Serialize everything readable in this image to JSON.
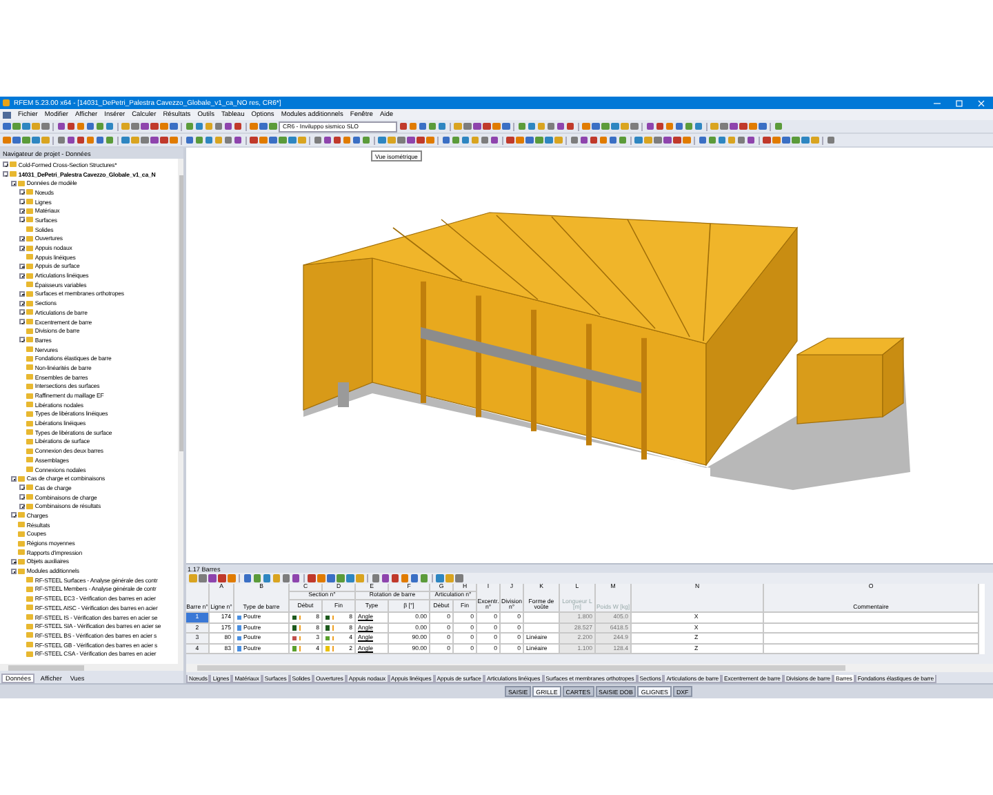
{
  "window": {
    "title": "RFEM 5.23.00 x64 - [14031_DePetri_Palestra Cavezzo_Globale_v1_ca_NO res, CR6*]"
  },
  "menu": [
    "Fichier",
    "Modifier",
    "Afficher",
    "Insérer",
    "Calculer",
    "Résultats",
    "Outils",
    "Tableau",
    "Options",
    "Modules additionnels",
    "Fenêtre",
    "Aide"
  ],
  "toolbar": {
    "load_case": "CR6 - Inviluppo sismico SLO",
    "tooltip": "Vue isométrique"
  },
  "navigator": {
    "title": "Navigateur de projet - Données",
    "tree": [
      {
        "label": "Cold-Formed Cross-Section Structures*",
        "expanded": false
      },
      {
        "label": "14031_DePetri_Palestra Cavezzo_Globale_v1_ca_N",
        "expanded": true,
        "children": [
          {
            "label": "Données de modèle",
            "expanded": true,
            "children": [
              {
                "label": "Nœuds",
                "expanded": false
              },
              {
                "label": "Lignes",
                "expanded": false
              },
              {
                "label": "Matériaux",
                "expanded": false
              },
              {
                "label": "Surfaces",
                "expanded": false
              },
              {
                "label": "Solides"
              },
              {
                "label": "Ouvertures",
                "expanded": false
              },
              {
                "label": "Appuis nodaux",
                "expanded": false
              },
              {
                "label": "Appuis linéiques"
              },
              {
                "label": "Appuis de surface",
                "expanded": false
              },
              {
                "label": "Articulations linéiques",
                "expanded": false
              },
              {
                "label": "Épaisseurs variables"
              },
              {
                "label": "Surfaces et membranes orthotropes",
                "expanded": false
              },
              {
                "label": "Sections",
                "expanded": false
              },
              {
                "label": "Articulations de barre",
                "expanded": false
              },
              {
                "label": "Excentrement de barre",
                "expanded": false
              },
              {
                "label": "Divisions de barre"
              },
              {
                "label": "Barres",
                "expanded": false
              },
              {
                "label": "Nervures"
              },
              {
                "label": "Fondations élastiques de barre"
              },
              {
                "label": "Non-linéarités de barre"
              },
              {
                "label": "Ensembles de barres"
              },
              {
                "label": "Intersections des surfaces"
              },
              {
                "label": "Raffinement du maillage EF"
              },
              {
                "label": "Libérations nodales"
              },
              {
                "label": "Types de libérations linéiques"
              },
              {
                "label": "Libérations linéiques"
              },
              {
                "label": "Types de libérations de surface"
              },
              {
                "label": "Libérations de surface"
              },
              {
                "label": "Connexion des deux barres"
              },
              {
                "label": "Assemblages"
              },
              {
                "label": "Connexions nodales"
              }
            ]
          },
          {
            "label": "Cas de charge et combinaisons",
            "expanded": true,
            "children": [
              {
                "label": "Cas de charge",
                "expanded": false
              },
              {
                "label": "Combinaisons de charge",
                "expanded": false
              },
              {
                "label": "Combinaisons de résultats",
                "expanded": false
              }
            ]
          },
          {
            "label": "Charges",
            "expanded": false
          },
          {
            "label": "Résultats"
          },
          {
            "label": "Coupes"
          },
          {
            "label": "Régions moyennes"
          },
          {
            "label": "Rapports d'impression"
          },
          {
            "label": "Objets auxiliaires",
            "expanded": false
          },
          {
            "label": "Modules additionnels",
            "expanded": true,
            "children": [
              {
                "label": "RF-STEEL Surfaces - Analyse générale des contr"
              },
              {
                "label": "RF-STEEL Members - Analyse générale de contr"
              },
              {
                "label": "RF-STEEL EC3 - Vérification des barres en acier"
              },
              {
                "label": "RF-STEEL AISC - Vérification des barres en acier"
              },
              {
                "label": "RF-STEEL IS - Vérification des barres en acier se"
              },
              {
                "label": "RF-STEEL SIA - Vérification des barres en acier se"
              },
              {
                "label": "RF-STEEL BS - Vérification des barres en acier s"
              },
              {
                "label": "RF-STEEL GB - Vérification des barres en acier s"
              },
              {
                "label": "RF-STEEL CSA - Vérification des barres en acier"
              }
            ]
          }
        ]
      }
    ],
    "tabs": [
      {
        "label": "Données",
        "selected": true
      },
      {
        "label": "Afficher",
        "selected": false
      },
      {
        "label": "Vues",
        "selected": false
      }
    ]
  },
  "table": {
    "title": "1.17 Barres",
    "header": [
      {
        "label": "Barre n°"
      },
      {
        "letter": "A",
        "label": "Ligne n°"
      },
      {
        "letter": "B",
        "label": "Type de barre"
      },
      {
        "group": "Section n°",
        "columns": [
          {
            "letter": "C",
            "label": "Début"
          },
          {
            "letter": "D",
            "label": "Fin"
          }
        ]
      },
      {
        "group": "Rotation de barre",
        "columns": [
          {
            "letter": "E",
            "label": "Type"
          },
          {
            "letter": "F",
            "label": "β [°]"
          }
        ]
      },
      {
        "group": "Articulation n°",
        "columns": [
          {
            "letter": "G",
            "label": "Début"
          },
          {
            "letter": "H",
            "label": "Fin"
          }
        ]
      },
      {
        "letter": "I",
        "label": "Excentr. n°"
      },
      {
        "letter": "J",
        "label": "Division n°"
      },
      {
        "letter": "K",
        "label": "Forme de voûte"
      },
      {
        "letter": "L",
        "label": "Longueur L [m]",
        "disabled": true
      },
      {
        "letter": "M",
        "label": "Poids W [kg]",
        "disabled": true
      },
      {
        "letter": "N"
      },
      {
        "letter": "O",
        "label": "Commentaire"
      }
    ],
    "rows": [
      {
        "number": "1",
        "selected": true,
        "cells": [
          "174",
          {
            "text": "Poutre",
            "color": "#4a8fe0"
          },
          {
            "text": "8",
            "color": "#1e5a1e"
          },
          {
            "text": "8",
            "color": "#1e5a1e"
          },
          "Angle",
          "0.00",
          "0",
          "0",
          "0",
          "0",
          null,
          "1.800",
          "405.0",
          "X"
        ]
      },
      {
        "number": "2",
        "selected": false,
        "cells": [
          "175",
          {
            "text": "Poutre",
            "color": "#4a8fe0"
          },
          {
            "text": "8",
            "color": "#1e5a1e"
          },
          {
            "text": "8",
            "color": "#1e5a1e"
          },
          "Angle",
          "0.00",
          "0",
          "0",
          "0",
          "0",
          null,
          "28.527",
          "6418.5",
          "X"
        ]
      },
      {
        "number": "3",
        "selected": false,
        "cells": [
          "80",
          {
            "text": "Poutre",
            "color": "#4a8fe0"
          },
          {
            "text": "3",
            "color": "#c0504d"
          },
          {
            "text": "4",
            "color": "#5aa02c"
          },
          "Angle",
          "90.00",
          "0",
          "0",
          "0",
          "0",
          "Linéaire",
          "2.200",
          "244.9",
          "Z"
        ]
      },
      {
        "number": "4",
        "selected": false,
        "cells": [
          "83",
          {
            "text": "Poutre",
            "color": "#4a8fe0"
          },
          {
            "text": "4",
            "color": "#5aa02c"
          },
          {
            "text": "2",
            "color": "#e8c000"
          },
          "Angle",
          "90.00",
          "0",
          "0",
          "0",
          "0",
          "Linéaire",
          "1.100",
          "128.4",
          "Z"
        ]
      }
    ],
    "sheets": [
      {
        "label": "Nœuds",
        "selected": false
      },
      {
        "label": "Lignes",
        "selected": false
      },
      {
        "label": "Matériaux",
        "selected": false
      },
      {
        "label": "Surfaces",
        "selected": false
      },
      {
        "label": "Solides",
        "selected": false
      },
      {
        "label": "Ouvertures",
        "selected": false
      },
      {
        "label": "Appuis nodaux",
        "selected": false
      },
      {
        "label": "Appuis linéiques",
        "selected": false
      },
      {
        "label": "Appuis de surface",
        "selected": false
      },
      {
        "label": "Articulations linéiques",
        "selected": false
      },
      {
        "label": "Surfaces et membranes orthotropes",
        "selected": false
      },
      {
        "label": "Sections",
        "selected": false
      },
      {
        "label": "Articulations de barre",
        "selected": false
      },
      {
        "label": "Excentrement de barre",
        "selected": false
      },
      {
        "label": "Divisions de barre",
        "selected": false
      },
      {
        "label": "Barres",
        "selected": true
      },
      {
        "label": "Fondations élastiques de barre",
        "selected": false
      }
    ]
  },
  "status_bar": [
    {
      "label": "SAISIE",
      "on": false
    },
    {
      "label": "GRILLE",
      "on": true
    },
    {
      "label": "CARTES",
      "on": false
    },
    {
      "label": "SAISIE DOB",
      "on": false
    },
    {
      "label": "GLIGNES",
      "on": true
    },
    {
      "label": "DXF",
      "on": false
    }
  ]
}
